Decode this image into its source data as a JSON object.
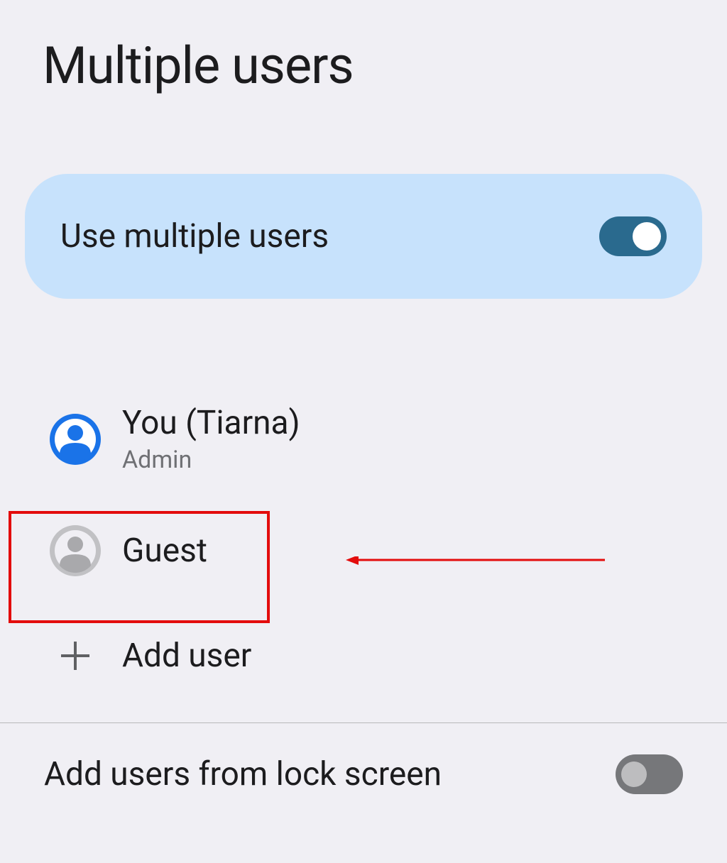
{
  "header": {
    "title": "Multiple users"
  },
  "main_toggle": {
    "label": "Use multiple users",
    "state": "on"
  },
  "users": {
    "owner": {
      "name": "You (Tiarna)",
      "subtitle": "Admin"
    },
    "guest": {
      "name": "Guest"
    },
    "add_label": "Add user"
  },
  "lock_screen": {
    "label": "Add users from lock screen",
    "state": "off"
  },
  "annotation": {
    "highlight_color": "#e30c0c"
  }
}
